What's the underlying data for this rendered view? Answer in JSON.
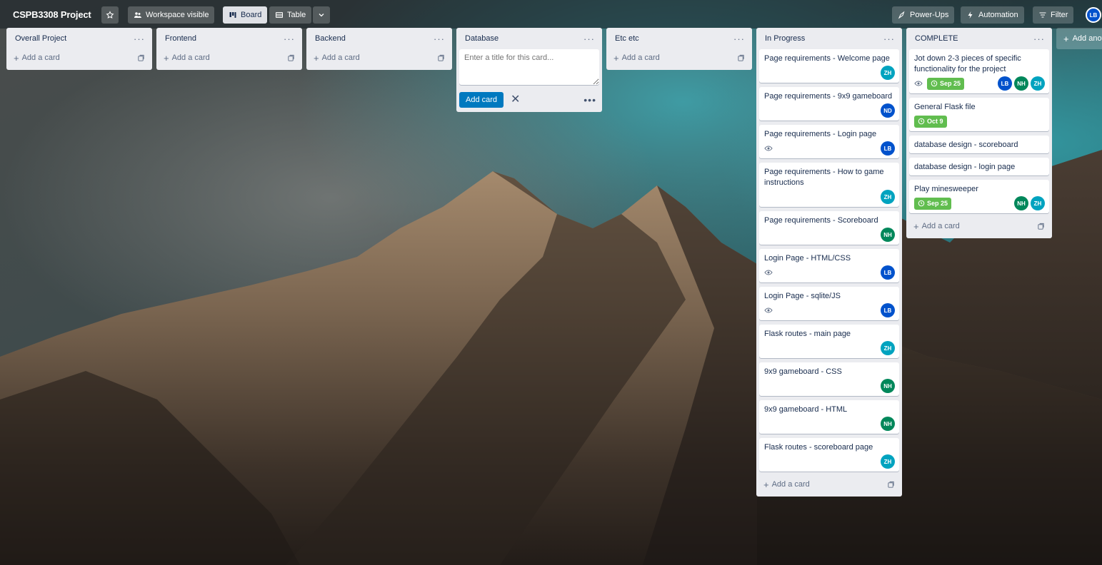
{
  "board": {
    "title": "CSPB3308 Project",
    "star_icon": "star-icon",
    "visibility_label": "Workspace visible",
    "views": [
      {
        "label": "Board",
        "icon": "board-icon",
        "active": true
      },
      {
        "label": "Table",
        "icon": "table-icon",
        "active": false
      }
    ],
    "right_buttons": [
      {
        "label": "Power-Ups",
        "icon": "rocket-icon"
      },
      {
        "label": "Automation",
        "icon": "lightning-icon"
      },
      {
        "label": "Filter",
        "icon": "filter-icon"
      }
    ],
    "user_avatar": "LB",
    "add_another_label": "Add another list"
  },
  "colors": {
    "LB": "#0052cc",
    "ND": "#0052cc",
    "ZH": "#00a3bf",
    "NH": "#00875a",
    "due_green": "#61bd4f",
    "list_bg": "#ebecf0",
    "primary": "#0079bf"
  },
  "lists": [
    {
      "title": "Overall Project",
      "add_label": "Add a card",
      "cards": []
    },
    {
      "title": "Frontend",
      "add_label": "Add a card",
      "cards": []
    },
    {
      "title": "Backend",
      "add_label": "Add a card",
      "cards": []
    },
    {
      "title": "Database",
      "composer": {
        "placeholder": "Enter a title for this card...",
        "button": "Add card"
      },
      "cards": []
    },
    {
      "title": "Etc etc",
      "add_label": "Add a card",
      "cards": []
    },
    {
      "title": "In Progress",
      "add_label": "Add a card",
      "cards": [
        {
          "title": "Page requirements - Welcome page",
          "members": [
            "ZH"
          ]
        },
        {
          "title": "Page requirements - 9x9 gameboard",
          "members": [
            "ND"
          ]
        },
        {
          "title": "Page requirements - Login page",
          "watch": true,
          "members": [
            "LB"
          ]
        },
        {
          "title": "Page requirements - How to game instructions",
          "members": [
            "ZH"
          ]
        },
        {
          "title": "Page requirements - Scoreboard",
          "members": [
            "NH"
          ]
        },
        {
          "title": "Login Page - HTML/CSS",
          "watch": true,
          "members": [
            "LB"
          ]
        },
        {
          "title": "Login Page - sqlite/JS",
          "watch": true,
          "members": [
            "LB"
          ]
        },
        {
          "title": "Flask routes - main page",
          "members": [
            "ZH"
          ]
        },
        {
          "title": "9x9 gameboard - CSS",
          "members": [
            "NH"
          ]
        },
        {
          "title": "9x9 gameboard - HTML",
          "members": [
            "NH"
          ]
        },
        {
          "title": "Flask routes - scoreboard page",
          "members": [
            "ZH"
          ]
        }
      ]
    },
    {
      "title": "COMPLETE",
      "add_label": "Add a card",
      "cards": [
        {
          "title": "Jot down 2-3 pieces of specific functionality for the project",
          "watch": true,
          "due": "Sep 25",
          "members": [
            "LB",
            "NH",
            "ZH"
          ]
        },
        {
          "title": "General Flask file",
          "due": "Oct 9",
          "members": []
        },
        {
          "title": "database design - scoreboard",
          "members": []
        },
        {
          "title": "database design - login page",
          "members": []
        },
        {
          "title": "Play minesweeper",
          "due": "Sep 25",
          "members": [
            "NH",
            "ZH"
          ]
        }
      ]
    }
  ]
}
